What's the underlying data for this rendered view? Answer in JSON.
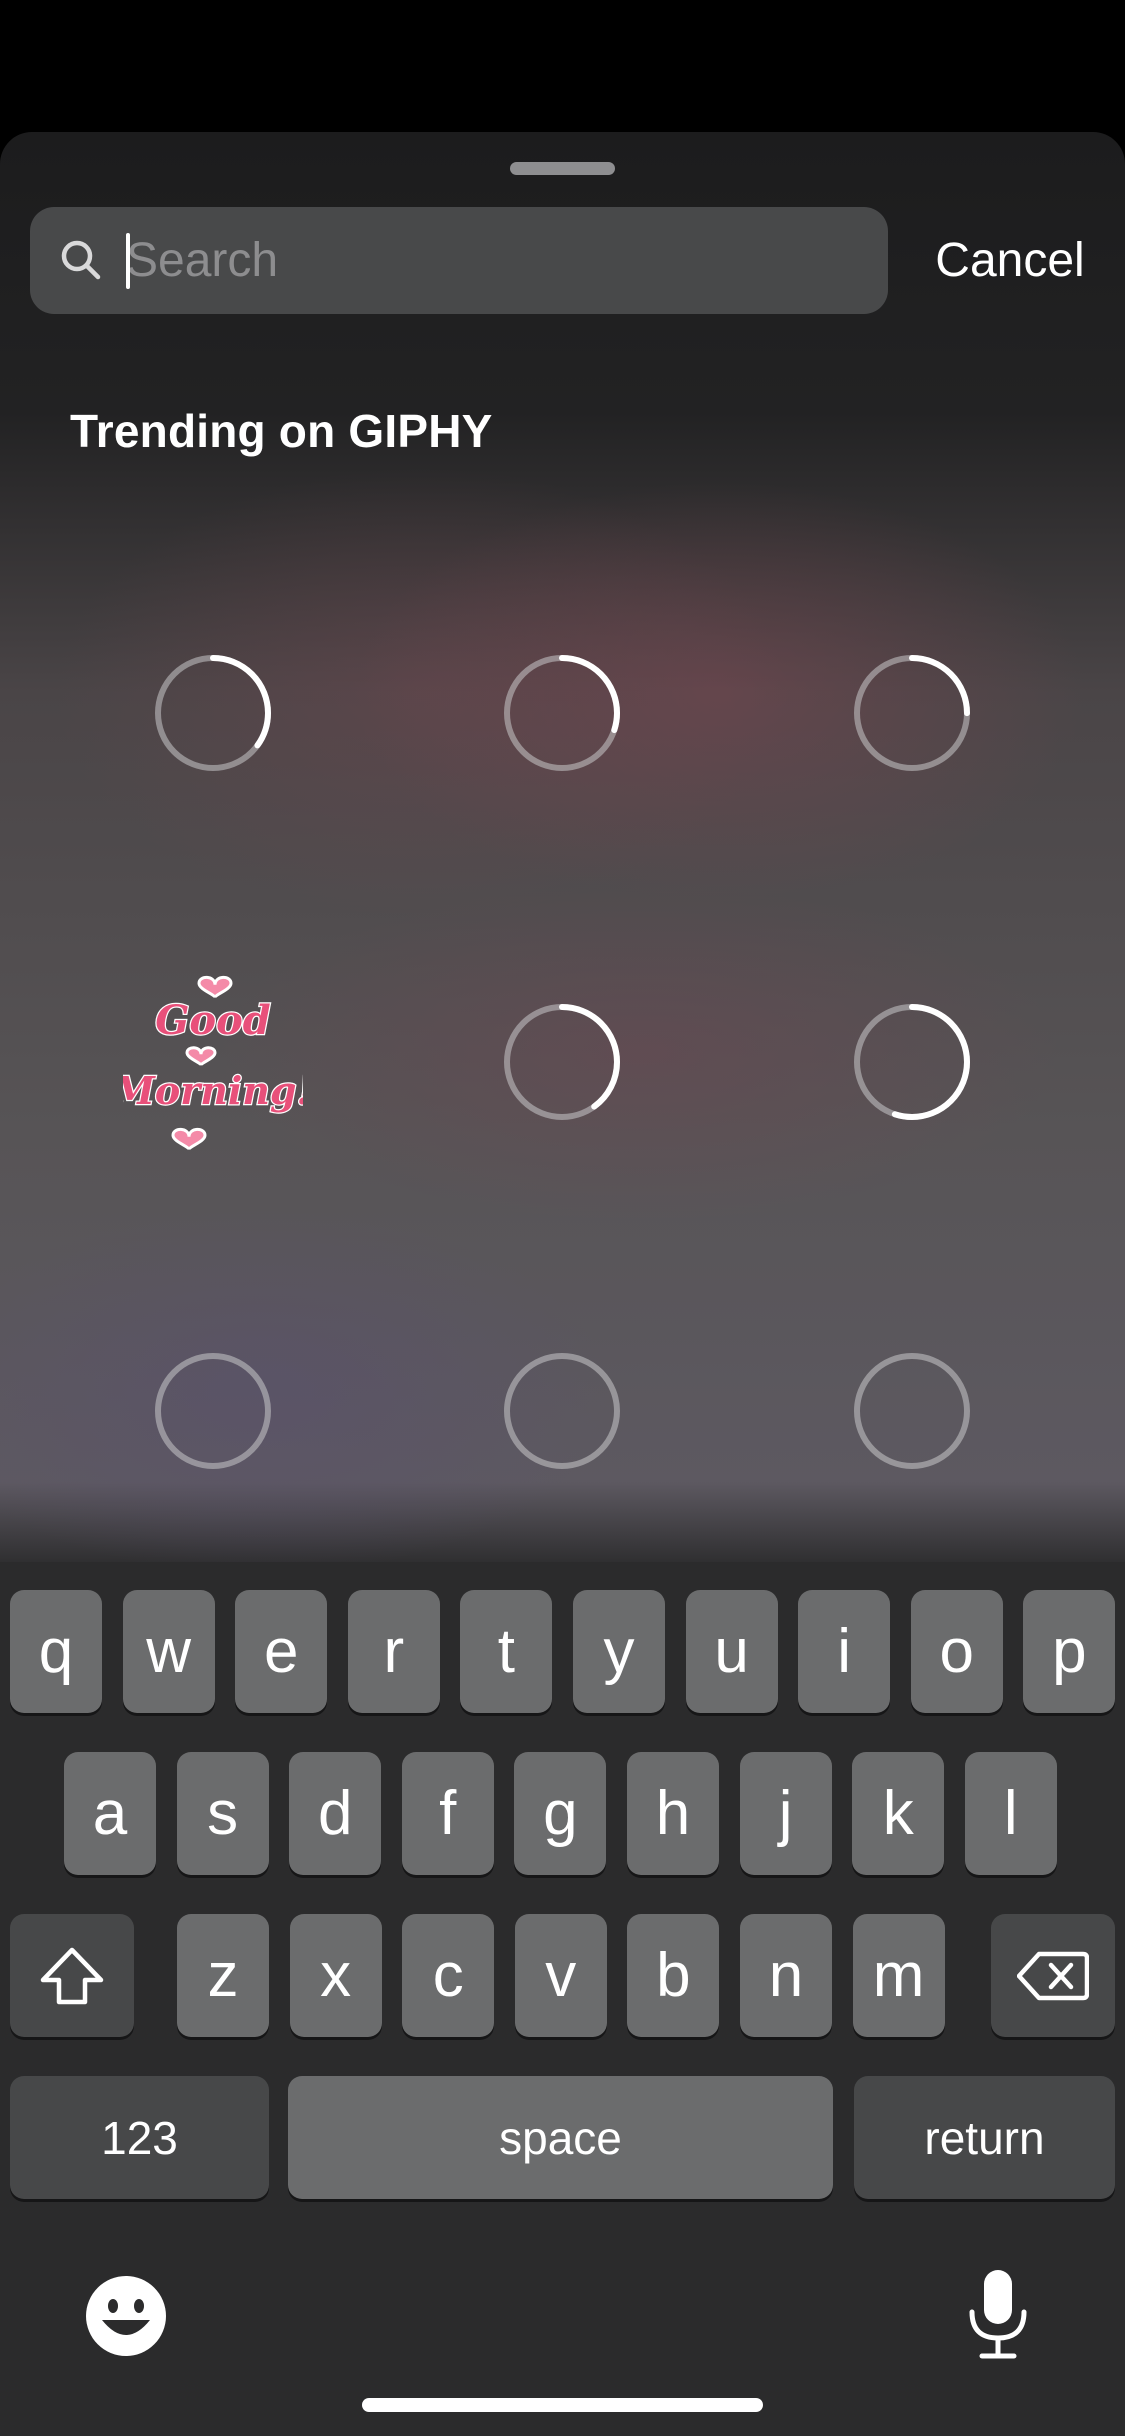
{
  "search": {
    "placeholder": "Search",
    "value": "",
    "cancel_label": "Cancel"
  },
  "section": {
    "title": "Trending on GIPHY"
  },
  "grid": [
    {
      "state": "loading",
      "progress": 0.35
    },
    {
      "state": "loading",
      "progress": 0.3
    },
    {
      "state": "loading",
      "progress": 0.25
    },
    {
      "state": "sticker",
      "sticker_text": [
        "Good",
        "Morning!"
      ]
    },
    {
      "state": "loading",
      "progress": 0.4
    },
    {
      "state": "loading",
      "progress": 0.55
    },
    {
      "state": "loading",
      "progress": 0
    },
    {
      "state": "loading",
      "progress": 0
    },
    {
      "state": "loading",
      "progress": 0
    }
  ],
  "keyboard": {
    "row1": [
      "q",
      "w",
      "e",
      "r",
      "t",
      "y",
      "u",
      "i",
      "o",
      "p"
    ],
    "row2": [
      "a",
      "s",
      "d",
      "f",
      "g",
      "h",
      "j",
      "k",
      "l"
    ],
    "row3": [
      "z",
      "x",
      "c",
      "v",
      "b",
      "n",
      "m"
    ],
    "numbers_label": "123",
    "space_label": "space",
    "return_label": "return",
    "shift_icon": "shift-icon",
    "delete_icon": "delete-icon",
    "emoji_icon": "emoji-icon",
    "mic_icon": "microphone-icon"
  },
  "colors": {
    "sheet_background": "#1c1c1d",
    "search_field": "#48494a",
    "key_light": "#6b6c6d",
    "key_dark": "#474849",
    "sticker_pink": "#e8507a"
  }
}
